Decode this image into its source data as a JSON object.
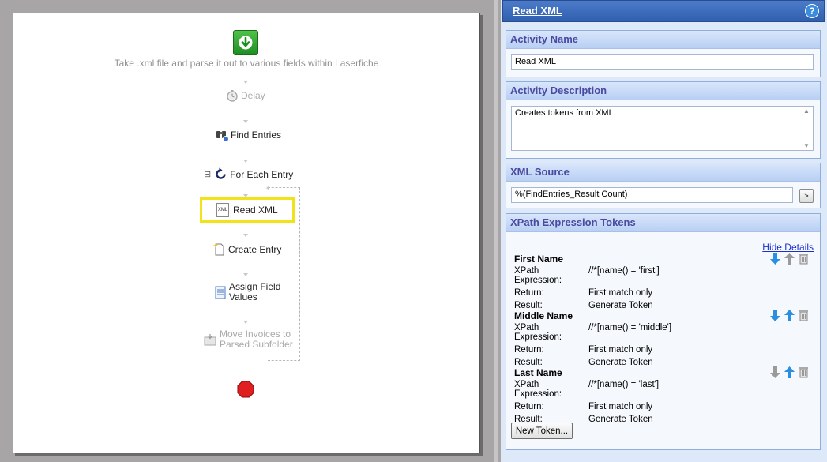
{
  "workflow": {
    "start_description": "Take .xml file and parse it out to various fields within Laserfiche",
    "nodes": [
      {
        "label": "Delay",
        "icon": "stopwatch-icon",
        "disabled": true
      },
      {
        "label": "Find Entries",
        "icon": "binoculars-icon",
        "disabled": false
      },
      {
        "label": "For Each Entry",
        "icon": "loop-icon",
        "disabled": false
      },
      {
        "label": "Read XML",
        "icon": "xml-document-icon",
        "disabled": false,
        "selected": true
      },
      {
        "label": "Create Entry",
        "icon": "new-document-icon",
        "disabled": false
      },
      {
        "label": "Assign Field",
        "label2": "Values",
        "icon": "field-values-icon",
        "disabled": false
      },
      {
        "label": "Move Invoices to",
        "label2": "Parsed Subfolder",
        "icon": "move-folder-icon",
        "disabled": true
      }
    ],
    "collapse_glyph": "⊟",
    "xml_icon_text": "XML"
  },
  "panel": {
    "title": "Read XML",
    "help_glyph": "?",
    "activity_name": {
      "label": "Activity Name",
      "value": "Read XML"
    },
    "activity_description": {
      "label": "Activity Description",
      "value": "Creates tokens from XML."
    },
    "xml_source": {
      "label": "XML Source",
      "value": "%(FindEntries_Result Count)",
      "button": ">"
    },
    "xpath": {
      "label": "XPath Expression Tokens",
      "hide_details": "Hide Details",
      "field_labels": {
        "expression": "XPath Expression:",
        "return": "Return:",
        "result": "Result:"
      },
      "tokens": [
        {
          "name": "First Name",
          "expression": "//*[name() = 'first']",
          "return": "First match only",
          "result": "Generate Token"
        },
        {
          "name": "Middle Name",
          "expression": "//*[name() = 'middle']",
          "return": "First match only",
          "result": "Generate Token"
        },
        {
          "name": "Last Name",
          "expression": "//*[name() = 'last']",
          "return": "First match only",
          "result": "Generate Token"
        }
      ],
      "new_token_label": "New Token..."
    }
  },
  "colors": {
    "start": "#2fa12d",
    "selection": "#f2e219",
    "panel_header": "#3d6dbd",
    "stop": "#e02020"
  }
}
